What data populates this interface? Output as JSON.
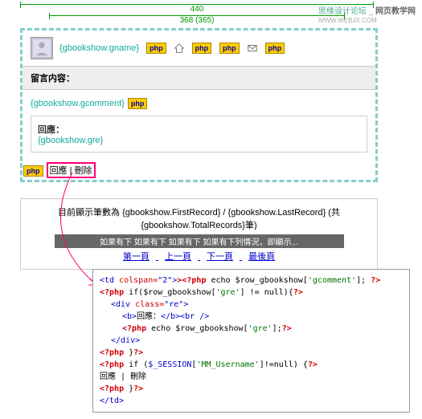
{
  "header": {
    "site1": "思缘设计论坛",
    "site2": "网页教学网",
    "url": "WWW.WEBJX.COM"
  },
  "rulers": {
    "outer": "440",
    "inner": "368 (365)"
  },
  "preview": {
    "name_field": "{gbookshow.gname}",
    "php_label": "php",
    "section_title": "留言内容：",
    "comment_field": "{gbookshow.gcomment}",
    "reply_label": "回應：",
    "reply_field": "{gbookshow.gre}",
    "action_reply": "回應",
    "action_delete": "刪除"
  },
  "footer": {
    "records": "目前顯示筆數為 {gbookshow.FirstRecord} / {gbookshow.LastRecord} (共{gbookshow.TotalRecords}筆)",
    "bar": "如果有下 如果有下 如果有下 如果有下列情況，即顯示...",
    "p1": "第一頁",
    "p2": "上一頁",
    "p3": "下一頁",
    "p4": "最後頁"
  },
  "code": {
    "l1a": "<td",
    "l1b": " colspan=",
    "l1c": "\"2\"",
    "l1d": "><?php",
    "l1e": " echo $row_gbookshow[",
    "l1f": "'gcomment'",
    "l1g": "]; ",
    "l1h": "?>",
    "l2a": "<?php",
    "l2b": " if($row_gbookshow[",
    "l2c": "'gre'",
    "l2d": "] != null){",
    "l2e": "?>",
    "l3a": "<div",
    "l3b": " class=",
    "l3c": "\"re\"",
    "l3d": ">",
    "l4a": "<b>",
    "l4b": "回應：",
    "l4c": "</b><br />",
    "l5a": "<?php",
    "l5b": " echo $row_gbookshow[",
    "l5c": "'gre'",
    "l5d": "];",
    "l5e": "?>",
    "l6": "</div>",
    "l7a": "<?php",
    "l7b": " }",
    "l7c": "?>",
    "l8a": "<?php",
    "l8b": " if ($_SESSION[",
    "l8c": "'MM_Username'",
    "l8d": "]!=null) {",
    "l8e": "?>",
    "l9": "回應 | 刪除",
    "l10a": "<?php",
    "l10b": " }",
    "l10c": "?>",
    "l11": "</td>"
  }
}
